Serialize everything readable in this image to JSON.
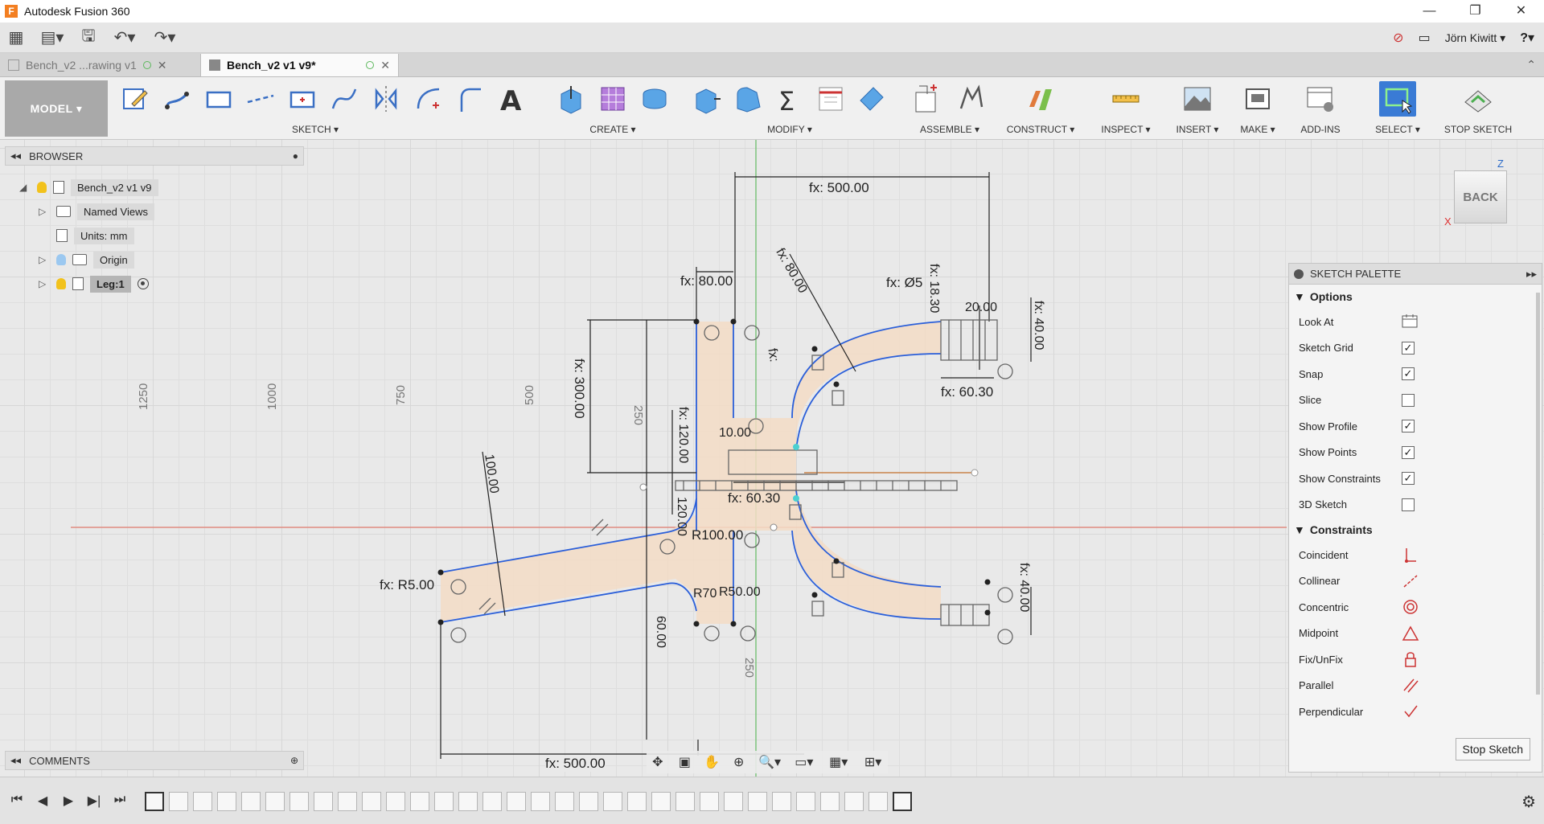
{
  "window": {
    "title": "Autodesk Fusion 360",
    "minimize": "—",
    "restore": "❐",
    "close": "✕",
    "logo": "F"
  },
  "qab": {
    "grid": "▦",
    "file": "▤▾",
    "save": "🖫",
    "undo": "↶▾",
    "redo": "↷▾",
    "user": "Jörn Kiwitt ▾",
    "help": "?▾",
    "offline": "⊘",
    "chat": "▭"
  },
  "tabs": [
    {
      "label": "Bench_v2 ...rawing v1",
      "close": "✕"
    },
    {
      "label": "Bench_v2 v1 v9*",
      "close": "✕"
    }
  ],
  "tabs_collapse": "⌃",
  "toolbar": {
    "workspace": "MODEL ▾",
    "groups": {
      "sketch": "SKETCH ▾",
      "create": "CREATE ▾",
      "modify": "MODIFY ▾",
      "assemble": "ASSEMBLE ▾",
      "construct": "CONSTRUCT ▾",
      "inspect": "INSPECT ▾",
      "insert": "INSERT ▾",
      "make": "MAKE ▾",
      "addins": "ADD-INS",
      "select": "SELECT ▾",
      "stop": "STOP SKETCH"
    }
  },
  "browser": {
    "title": "BROWSER",
    "root": "Bench_v2 v1 v9",
    "items": [
      {
        "label": "Named Views"
      },
      {
        "label": "Units: mm"
      },
      {
        "label": "Origin"
      },
      {
        "label": "Leg:1"
      }
    ]
  },
  "comments": {
    "title": "COMMENTS"
  },
  "viewcube": {
    "face": "BACK",
    "z": "Z",
    "x": "X"
  },
  "dimensions": {
    "top_width": "fx: 500.00",
    "bottom_width": "fx: 500.00",
    "d80a": "fx: 80.00",
    "d80b": "fx: 80.00",
    "d300": "fx: 300.00",
    "d120a": "fx: 120.00",
    "d120b": "120.00",
    "d18": "fx: 18.30",
    "d20": "20.00",
    "d40a": "fx: 40.00",
    "d40b": "fx: 40.00",
    "d60a": "fx: 60.30",
    "d60b": "fx: 60.30",
    "d10": "10.00",
    "d100": "100.00",
    "r5": "fx: R5.00",
    "r100": "R100.00",
    "r70": "R70",
    "r50": "R50.00",
    "d60c": "60.00",
    "fxphi": "fx: Ø5",
    "fx_small": "fx:",
    "ruler": [
      "1250",
      "1000",
      "750",
      "500",
      "250",
      "250"
    ]
  },
  "palette": {
    "title": "SKETCH PALETTE",
    "options_title": "Options",
    "options": [
      {
        "label": "Look At"
      },
      {
        "label": "Sketch Grid",
        "mark": "✓"
      },
      {
        "label": "Snap",
        "mark": "✓"
      },
      {
        "label": "Slice",
        "mark": ""
      },
      {
        "label": "Show Profile",
        "mark": "✓"
      },
      {
        "label": "Show Points",
        "mark": "✓"
      },
      {
        "label": "Show Constraints",
        "mark": "✓"
      },
      {
        "label": "3D Sketch",
        "mark": ""
      }
    ],
    "constraints_title": "Constraints",
    "constraints": [
      {
        "label": "Coincident",
        "icon": "coincident-icon"
      },
      {
        "label": "Collinear",
        "icon": "collinear-icon"
      },
      {
        "label": "Concentric",
        "icon": "concentric-icon"
      },
      {
        "label": "Midpoint",
        "icon": "midpoint-icon"
      },
      {
        "label": "Fix/UnFix",
        "icon": "lock-icon"
      },
      {
        "label": "Parallel",
        "icon": "parallel-icon"
      },
      {
        "label": "Perpendicular",
        "icon": "perpendicular-icon"
      }
    ],
    "stop_button": "Stop Sketch"
  },
  "navbar": [
    "✥",
    "▣",
    "✋",
    "⊕",
    "🔍▾",
    "▭▾",
    "▦▾",
    "⊞▾"
  ],
  "timeline": {
    "controls": [
      "⏮",
      "◀",
      "▶",
      "▶|",
      "⏭"
    ],
    "settings": "⚙"
  },
  "colors": {
    "accent": "#3a7bd5",
    "profile": "#f5e1cc",
    "curve": "#2b5fd9",
    "axis_red": "#d9534f",
    "axis_green": "#4caf50"
  }
}
